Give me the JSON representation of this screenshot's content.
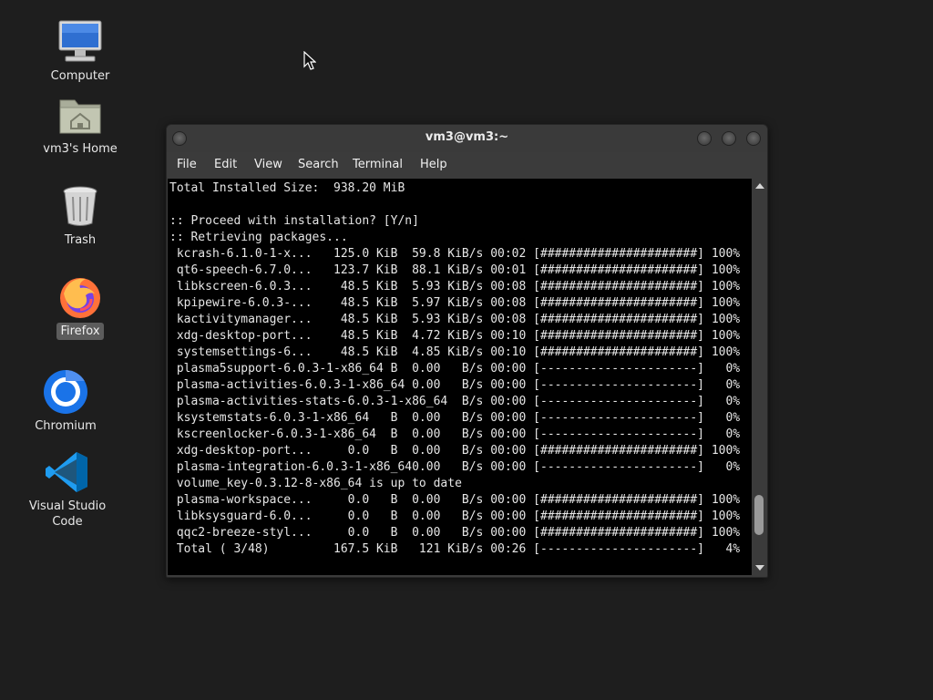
{
  "desktop": {
    "icons": [
      {
        "label": "Computer",
        "icon": "computer-icon"
      },
      {
        "label": "vm3's Home",
        "icon": "home-folder-icon"
      },
      {
        "label": "Trash",
        "icon": "trash-icon"
      },
      {
        "label": "Firefox",
        "icon": "firefox-icon",
        "selected": true
      },
      {
        "label": "Chromium",
        "icon": "chromium-icon"
      },
      {
        "label": "Visual Studio Code",
        "icon": "vscode-icon"
      }
    ]
  },
  "window": {
    "title": "vm3@vm3:~",
    "menu": [
      "File",
      "Edit",
      "View",
      "Search",
      "Terminal",
      "Help"
    ]
  },
  "terminal": {
    "lines": [
      "Total Installed Size:  938.20 MiB",
      "",
      ":: Proceed with installation? [Y/n]",
      ":: Retrieving packages...",
      " kcrash-6.1.0-1-x...   125.0 KiB  59.8 KiB/s 00:02 [######################] 100%",
      " qt6-speech-6.7.0...   123.7 KiB  88.1 KiB/s 00:01 [######################] 100%",
      " libkscreen-6.0.3...    48.5 KiB  5.93 KiB/s 00:08 [######################] 100%",
      " kpipewire-6.0.3-...    48.5 KiB  5.97 KiB/s 00:08 [######################] 100%",
      " kactivitymanager...    48.5 KiB  5.93 KiB/s 00:08 [######################] 100%",
      " xdg-desktop-port...    48.5 KiB  4.72 KiB/s 00:10 [######################] 100%",
      " systemsettings-6...    48.5 KiB  4.85 KiB/s 00:10 [######################] 100%",
      " plasma5support-6.0.3-1-x86_64 B  0.00   B/s 00:00 [----------------------]   0%",
      " plasma-activities-6.0.3-1-x86_64 0.00   B/s 00:00 [----------------------]   0%",
      " plasma-activities-stats-6.0.3-1-x86_64  B/s 00:00 [----------------------]   0%",
      " ksystemstats-6.0.3-1-x86_64   B  0.00   B/s 00:00 [----------------------]   0%",
      " kscreenlocker-6.0.3-1-x86_64  B  0.00   B/s 00:00 [----------------------]   0%",
      " xdg-desktop-port...     0.0   B  0.00   B/s 00:00 [######################] 100%",
      " plasma-integration-6.0.3-1-x86_640.00   B/s 00:00 [----------------------]   0%",
      " volume_key-0.3.12-8-x86_64 is up to date",
      " plasma-workspace...     0.0   B  0.00   B/s 00:00 [######################] 100%",
      " libksysguard-6.0...     0.0   B  0.00   B/s 00:00 [######################] 100%",
      " qqc2-breeze-styl...     0.0   B  0.00   B/s 00:00 [######################] 100%",
      " Total ( 3/48)         167.5 KiB   121 KiB/s 00:26 [----------------------]   4%"
    ]
  },
  "scrollbar": {
    "position": 0.92
  }
}
